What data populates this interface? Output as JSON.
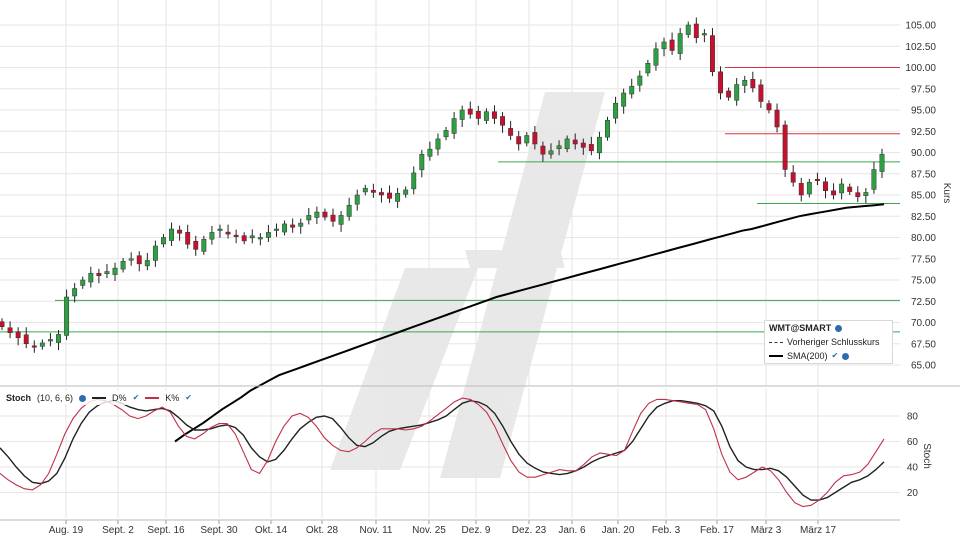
{
  "chart_data": [
    {
      "type": "candlestick",
      "symbol": "WMT@SMART",
      "ylabel": "Kurs",
      "ylim": [
        63,
        107
      ],
      "yticks": [
        "105.00",
        "102.50",
        "100.00",
        "97.50",
        "95.00",
        "92.50",
        "90.00",
        "87.50",
        "85.00",
        "82.50",
        "80.00",
        "77.50",
        "75.00",
        "72.50",
        "70.00",
        "67.50",
        "65.00"
      ],
      "xticks": [
        "Aug. 19",
        "Sept. 2",
        "Sept. 16",
        "Sept. 30",
        "Okt. 14",
        "Okt. 28",
        "Nov. 11",
        "Nov. 25",
        "Dez. 9",
        "Dez. 23",
        "Jan. 6",
        "Jan. 20",
        "Feb. 3",
        "Feb. 17",
        "März 3",
        "März 17"
      ],
      "legend": {
        "title": "WMT@SMART",
        "prev_close_label": "Vorheriger Schlusskurs",
        "sma_label": "SMA(200)"
      },
      "colors": {
        "up": "#2ea043",
        "down": "#c8102e",
        "sma": "#000000",
        "support": "#3aa84a",
        "resistance": "#d9303c",
        "grid": "#e6e6e6"
      },
      "horizontal_levels": [
        {
          "value": 100.0,
          "color": "#d9303c",
          "from": "Feb. 17"
        },
        {
          "value": 92.2,
          "color": "#d9303c",
          "from": "Feb. 17"
        },
        {
          "value": 88.9,
          "color": "#3aa84a",
          "from": "Dez. 9"
        },
        {
          "value": 84.0,
          "color": "#3aa84a",
          "from": "Feb. 17"
        },
        {
          "value": 72.6,
          "color": "#3aa84a",
          "from": "Aug. 19"
        },
        {
          "value": 68.9,
          "color": "#3aa84a",
          "from": "start"
        }
      ],
      "ohlc_close": [
        69.5,
        68.8,
        68.2,
        67.5,
        67.2,
        67.6,
        68.0,
        68.6,
        73.0,
        74.0,
        75.0,
        75.8,
        75.5,
        76.0,
        76.4,
        77.2,
        77.5,
        76.9,
        77.3,
        79.0,
        80.0,
        81.0,
        80.5,
        79.2,
        78.6,
        79.8,
        80.6,
        81.0,
        80.4,
        80.1,
        79.6,
        80.2,
        80.0,
        80.6,
        81.0,
        81.6,
        81.2,
        81.7,
        82.6,
        83.0,
        82.4,
        81.9,
        82.6,
        83.8,
        85.0,
        85.8,
        85.3,
        85.0,
        84.6,
        85.2,
        85.6,
        87.6,
        89.8,
        90.4,
        91.6,
        92.6,
        94.0,
        95.0,
        94.5,
        94.0,
        94.8,
        94.0,
        93.2,
        92.0,
        91.0,
        92.0,
        91.0,
        89.8,
        90.2,
        90.8,
        91.6,
        91.0,
        90.6,
        90.2,
        91.8,
        93.8,
        95.8,
        97.0,
        97.8,
        99.0,
        100.5,
        102.2,
        103.0,
        102.0,
        104.0,
        105.0,
        103.5,
        104.0,
        99.5,
        97.0,
        96.5,
        98.0,
        98.5,
        97.6,
        96.0,
        95.0,
        93.0,
        88.0,
        86.5,
        85.0,
        86.5,
        86.8,
        85.5,
        85.0,
        86.3,
        85.4,
        84.8,
        85.3,
        88.0,
        89.8
      ],
      "sma200": [
        56.0,
        56.8,
        57.5,
        58.2,
        59.0,
        59.8,
        60.5,
        61.2,
        62.0,
        62.6,
        63.2,
        63.8,
        64.2,
        64.6,
        65.0,
        65.4,
        65.8,
        66.2,
        66.6,
        67.0,
        67.4,
        67.8,
        68.2,
        68.6,
        69.0,
        69.4,
        69.8,
        70.2,
        70.6,
        71.0,
        71.4,
        71.8,
        72.2,
        72.6,
        73.0,
        73.3,
        73.6,
        73.9,
        74.2,
        74.5,
        74.8,
        75.1,
        75.4,
        75.7,
        76.0,
        76.3,
        76.6,
        76.9,
        77.2,
        77.5,
        77.8,
        78.1,
        78.4,
        78.7,
        79.0,
        79.3,
        79.6,
        79.9,
        80.2,
        80.5,
        80.8,
        81.0,
        81.3,
        81.6,
        81.9,
        82.2,
        82.5,
        82.7,
        82.9,
        83.1,
        83.3,
        83.5,
        83.6,
        83.7,
        83.8,
        83.9
      ],
      "sma_start_index": 34
    },
    {
      "type": "line",
      "title": "Stoch",
      "params": "(10, 6, 6)",
      "ylabel": "Stoch",
      "ylim": [
        5,
        95
      ],
      "yticks": [
        "80",
        "60",
        "40",
        "20"
      ],
      "series": [
        {
          "name": "D%",
          "color": "#222222",
          "values": [
            55,
            48,
            40,
            33,
            28,
            27,
            29,
            35,
            47,
            62,
            74,
            83,
            88,
            91,
            92,
            90,
            87,
            85,
            84,
            85,
            86,
            84,
            79,
            73,
            69,
            69,
            70,
            72,
            73,
            71,
            65,
            55,
            48,
            44,
            46,
            53,
            62,
            70,
            75,
            79,
            80,
            78,
            71,
            63,
            57,
            56,
            59,
            64,
            68,
            70,
            71,
            72,
            73,
            75,
            77,
            80,
            85,
            90,
            92,
            91,
            88,
            82,
            72,
            60,
            50,
            43,
            39,
            36,
            35,
            34,
            35,
            37,
            40,
            44,
            47,
            49,
            51,
            53,
            60,
            70,
            80,
            87,
            90,
            92,
            92,
            91,
            90,
            88,
            84,
            72,
            56,
            45,
            40,
            38,
            38,
            39,
            37,
            32,
            25,
            18,
            14,
            14,
            16,
            20,
            24,
            28,
            30,
            33,
            38,
            44
          ]
        },
        {
          "name": "K%",
          "color": "#c0304a",
          "values": [
            35,
            30,
            26,
            23,
            22,
            26,
            35,
            50,
            66,
            78,
            86,
            91,
            93,
            92,
            89,
            85,
            80,
            78,
            80,
            84,
            87,
            83,
            72,
            64,
            62,
            66,
            71,
            74,
            74,
            66,
            52,
            38,
            35,
            45,
            60,
            72,
            80,
            82,
            79,
            72,
            63,
            57,
            53,
            52,
            55,
            60,
            66,
            70,
            70,
            70,
            69,
            70,
            72,
            76,
            81,
            86,
            91,
            94,
            93,
            89,
            83,
            72,
            58,
            45,
            36,
            32,
            32,
            34,
            36,
            38,
            37,
            37,
            42,
            48,
            51,
            50,
            49,
            53,
            68,
            82,
            90,
            93,
            93,
            92,
            91,
            90,
            89,
            85,
            70,
            50,
            36,
            30,
            32,
            36,
            40,
            37,
            30,
            20,
            12,
            9,
            10,
            14,
            20,
            28,
            33,
            34,
            36,
            42,
            52,
            62
          ]
        }
      ]
    }
  ]
}
